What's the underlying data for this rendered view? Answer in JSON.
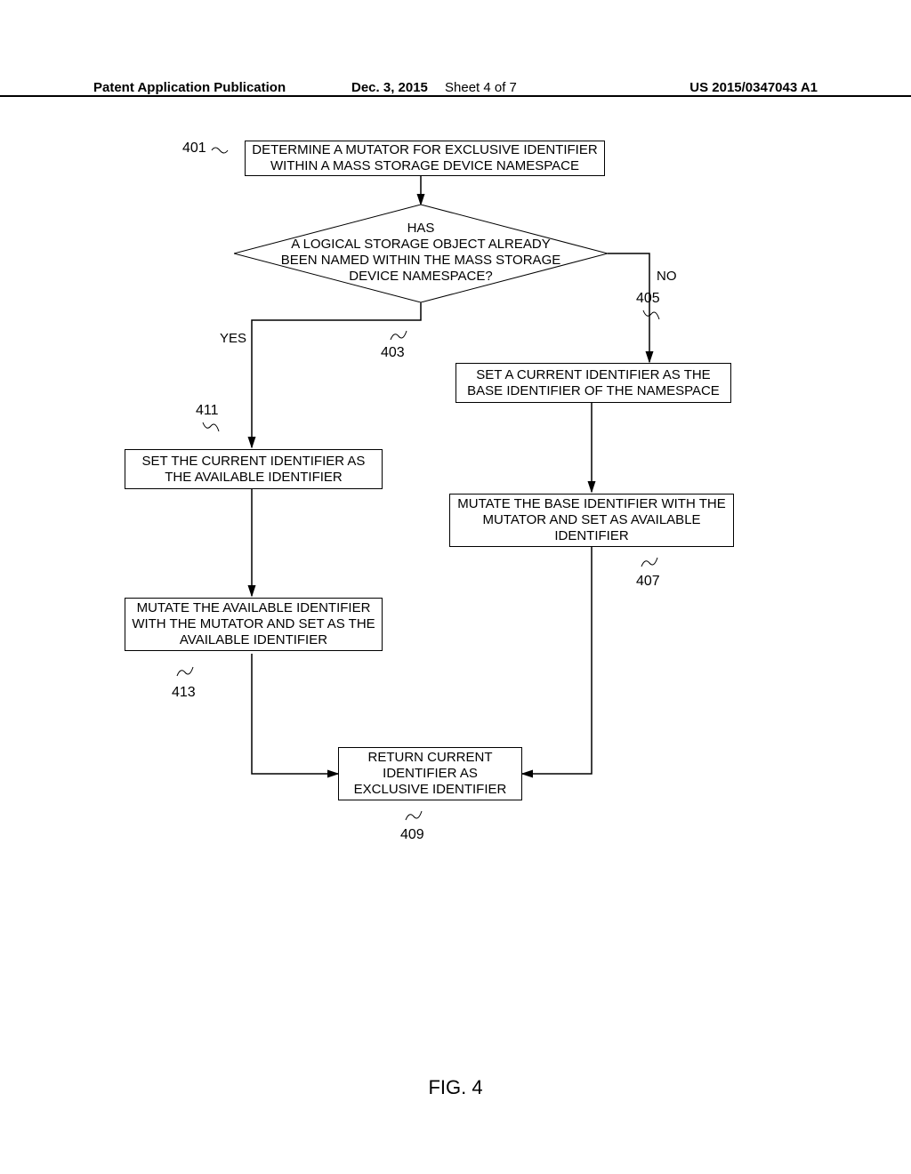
{
  "header": {
    "title": "Patent Application Publication",
    "date": "Dec. 3, 2015",
    "sheet": "Sheet 4 of 7",
    "pub": "US 2015/0347043 A1"
  },
  "refs": {
    "r401": "401",
    "r403": "403",
    "r405": "405",
    "r407": "407",
    "r409": "409",
    "r411": "411",
    "r413": "413"
  },
  "boxes": {
    "b401": "DETERMINE A MUTATOR FOR EXCLUSIVE IDENTIFIER WITHIN A MASS STORAGE DEVICE NAMESPACE",
    "b403": "HAS\nA LOGICAL STORAGE OBJECT ALREADY\nBEEN NAMED WITHIN THE MASS STORAGE\nDEVICE NAMESPACE?",
    "b405": "SET A CURRENT IDENTIFIER AS THE BASE IDENTIFIER OF THE NAMESPACE",
    "b407": "MUTATE THE BASE IDENTIFIER WITH THE MUTATOR AND SET AS AVAILABLE IDENTIFIER",
    "b409": "RETURN CURRENT IDENTIFIER AS EXCLUSIVE IDENTIFIER",
    "b411": "SET THE CURRENT IDENTIFIER AS THE AVAILABLE IDENTIFIER",
    "b413": "MUTATE THE AVAILABLE IDENTIFIER WITH THE MUTATOR AND SET AS THE AVAILABLE IDENTIFIER"
  },
  "labels": {
    "yes": "YES",
    "no": "NO"
  },
  "figure": "FIG. 4"
}
